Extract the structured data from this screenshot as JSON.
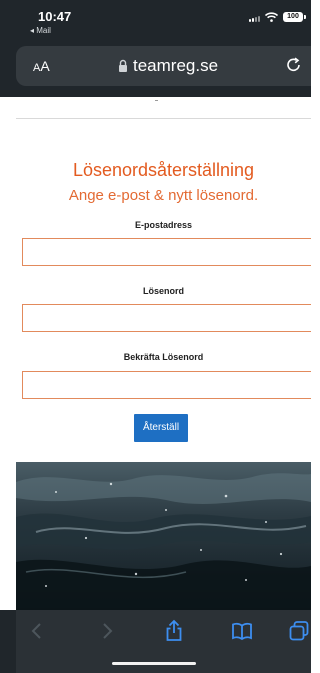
{
  "status_bar": {
    "time": "10:47",
    "back_label": "◂ Mail",
    "battery": "100"
  },
  "browser": {
    "text_size_label_small": "A",
    "text_size_label_large": "A",
    "url": "teamreg.se"
  },
  "form": {
    "title": "Lösenordsåterställning",
    "subtitle": "Ange e-post & nytt lösenord.",
    "email_label": "E-postadress",
    "password_label": "Lösenord",
    "confirm_label": "Bekräfta Lösenord",
    "email_value": "",
    "password_value": "",
    "confirm_value": "",
    "submit_label": "Återställ"
  },
  "colors": {
    "accent": "#e35b20",
    "button": "#1e6fc3",
    "chrome": "#20262b"
  },
  "toolbar": {
    "icons": [
      "back-icon",
      "forward-icon",
      "share-icon",
      "bookmarks-icon",
      "tabs-icon"
    ]
  }
}
